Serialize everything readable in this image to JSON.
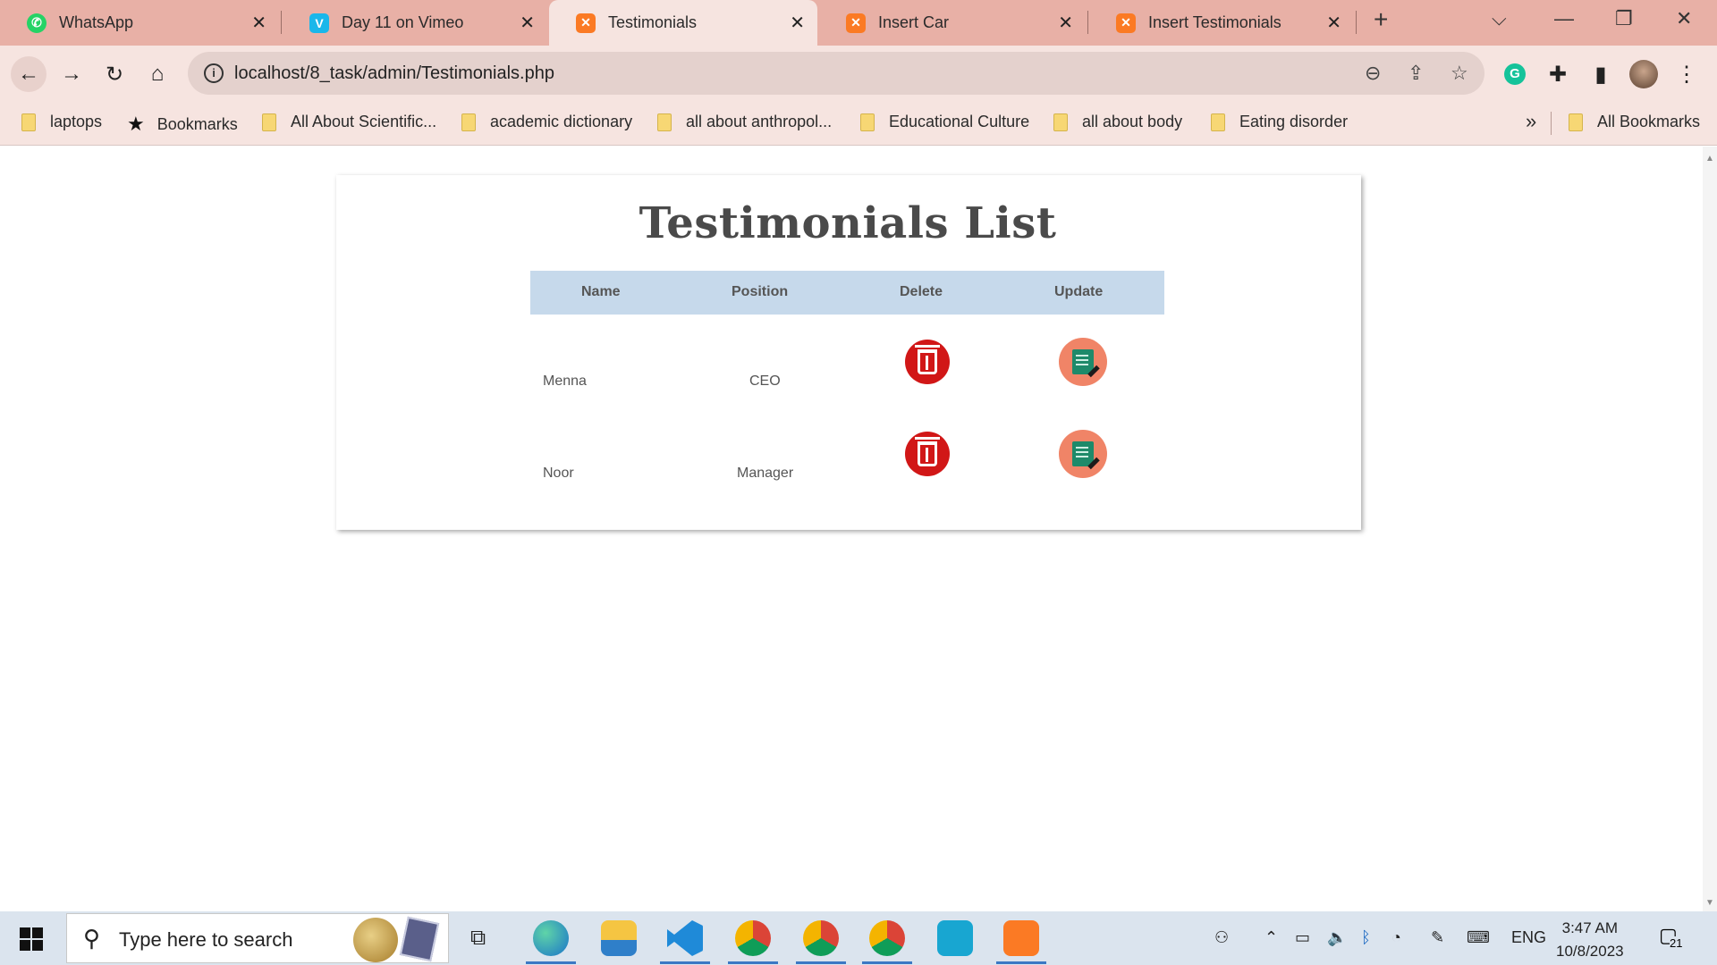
{
  "browser": {
    "tabs": [
      {
        "label": "WhatsApp",
        "icon": "whatsapp-icon",
        "color": "#25d366",
        "active": false
      },
      {
        "label": "Day 11 on Vimeo",
        "icon": "vimeo-icon",
        "color": "#1ab7ea",
        "active": false
      },
      {
        "label": "Testimonials",
        "icon": "xampp-icon",
        "color": "#fb7a24",
        "active": true
      },
      {
        "label": "Insert Car",
        "icon": "xampp-icon",
        "color": "#fb7a24",
        "active": false
      },
      {
        "label": "Insert Testimonials",
        "icon": "xampp-icon",
        "color": "#fb7a24",
        "active": false
      }
    ],
    "url": "localhost/8_task/admin/Testimonials.php",
    "bookmarks": [
      {
        "label": "laptops",
        "icon": "folder-icon"
      },
      {
        "label": "Bookmarks",
        "icon": "star-icon"
      },
      {
        "label": "All About Scientific...",
        "icon": "folder-icon"
      },
      {
        "label": "academic dictionary",
        "icon": "folder-icon"
      },
      {
        "label": "all about anthropol...",
        "icon": "folder-icon"
      },
      {
        "label": "Educational Culture",
        "icon": "folder-icon"
      },
      {
        "label": "all about body",
        "icon": "folder-icon"
      },
      {
        "label": "Eating disorder",
        "icon": "folder-icon"
      }
    ],
    "bookmarks_more": "»",
    "all_bookmarks": "All Bookmarks"
  },
  "page": {
    "title": "Testimonials List",
    "columns": [
      "Name",
      "Position",
      "Delete",
      "Update"
    ],
    "rows": [
      {
        "name": "Menna",
        "position": "CEO"
      },
      {
        "name": "Noor",
        "position": "Manager"
      }
    ]
  },
  "taskbar": {
    "search_placeholder": "Type here to search",
    "language": "ENG",
    "time": "3:47 AM",
    "date": "10/8/2023",
    "notification_count": "21"
  }
}
